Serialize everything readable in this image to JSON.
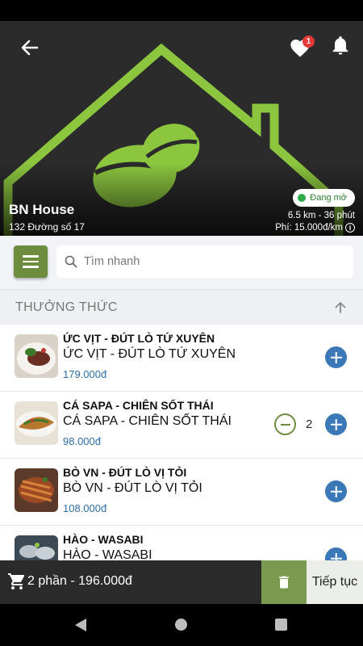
{
  "shop": {
    "name": "BN House",
    "address": "132 Đường số 17",
    "status": "Đang mở",
    "distance": "6.5 km - 36 phút",
    "fee": "Phí: 15.000đ/km",
    "favorite_count": "1"
  },
  "search": {
    "placeholder": "Tìm nhanh"
  },
  "category": {
    "title": "THƯỞNG THỨC"
  },
  "items": [
    {
      "name": "ỨC VỊT - ĐÚT LÒ TỨ XUYÊN",
      "subtitle": "ỨC VỊT - ĐÚT LÒ TỨ XUYÊN",
      "price": "179.000đ"
    },
    {
      "name": "CÁ SAPA - CHIÊN SỐT THÁI",
      "subtitle": "CÁ SAPA - CHIÊN SỐT THÁI",
      "price": "98.000đ",
      "quantity": "2"
    },
    {
      "name": "BÒ VN - ĐÚT LÒ VỊ TỎI",
      "subtitle": "BÒ VN - ĐÚT LÒ VỊ TỎI",
      "price": "108.000đ"
    },
    {
      "name": "HÀO - WASABI",
      "subtitle": "HÀO - WASABI",
      "price": ""
    }
  ],
  "cart": {
    "summary": "2 phần -  196.000đ",
    "continue_label": "Tiếp tục"
  },
  "colors": {
    "brand_green": "#6e8c3e",
    "logo_green": "#8cc63f",
    "plus_blue": "#3b78b8",
    "price_blue": "#2f6ea8",
    "dark_bar": "#2b2b2b"
  },
  "icons": [
    "back-arrow-icon",
    "heart-icon",
    "bell-icon",
    "menu-icon",
    "search-icon",
    "chevron-up-icon",
    "plus-icon",
    "minus-icon",
    "cart-icon",
    "trash-icon",
    "info-icon"
  ]
}
